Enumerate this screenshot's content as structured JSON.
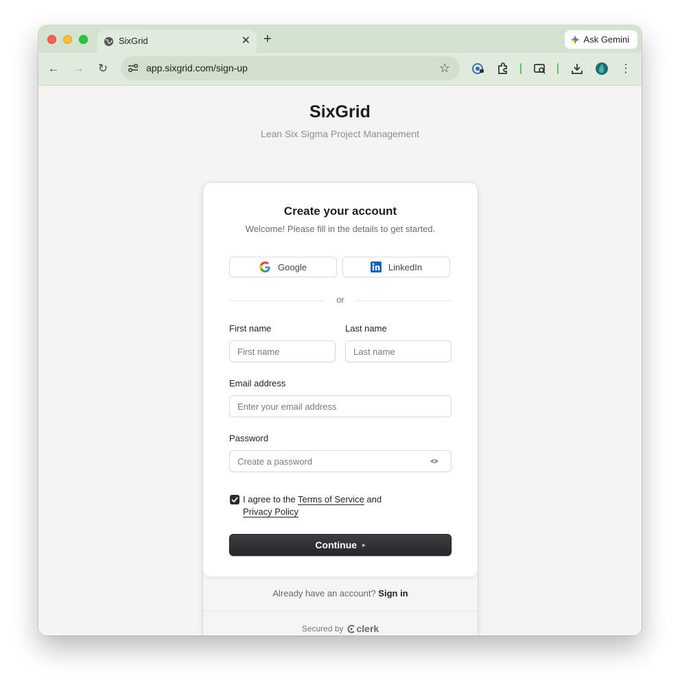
{
  "browser": {
    "tab_title": "SixGrid",
    "tab_close": "✕",
    "new_tab": "+",
    "gemini_label": "Ask Gemini",
    "url": "app.sixgrid.com/sign-up",
    "back": "←",
    "forward": "→",
    "reload": "↻",
    "star": "☆",
    "menu": "⋮"
  },
  "header": {
    "brand": "SixGrid",
    "tagline": "Lean Six Sigma Project Management"
  },
  "card": {
    "title": "Create your account",
    "subtitle": "Welcome! Please fill in the details to get started.",
    "google_label": "Google",
    "linkedin_label": "LinkedIn",
    "divider": "or",
    "first_name": {
      "label": "First name",
      "placeholder": "First name"
    },
    "last_name": {
      "label": "Last name",
      "placeholder": "Last name"
    },
    "email": {
      "label": "Email address",
      "placeholder": "Enter your email address"
    },
    "password": {
      "label": "Password",
      "placeholder": "Create a password"
    },
    "agree_prefix": "I agree to the ",
    "terms_link": "Terms of Service",
    "agree_mid": " and",
    "privacy_link": "Privacy Policy",
    "agree_checked": true,
    "continue_label": "Continue",
    "continue_arrow": "▸",
    "have_account": "Already have an account?",
    "sign_in": "Sign in",
    "secured_by": "Secured by",
    "clerk": "clerk"
  },
  "colors": {
    "tab_bar": "#d3e3cf",
    "toolbar": "#e1ebdd",
    "page_bg": "#f5f4f2",
    "button_dark": "#2c2d31",
    "linkedin": "#0a66c2"
  }
}
